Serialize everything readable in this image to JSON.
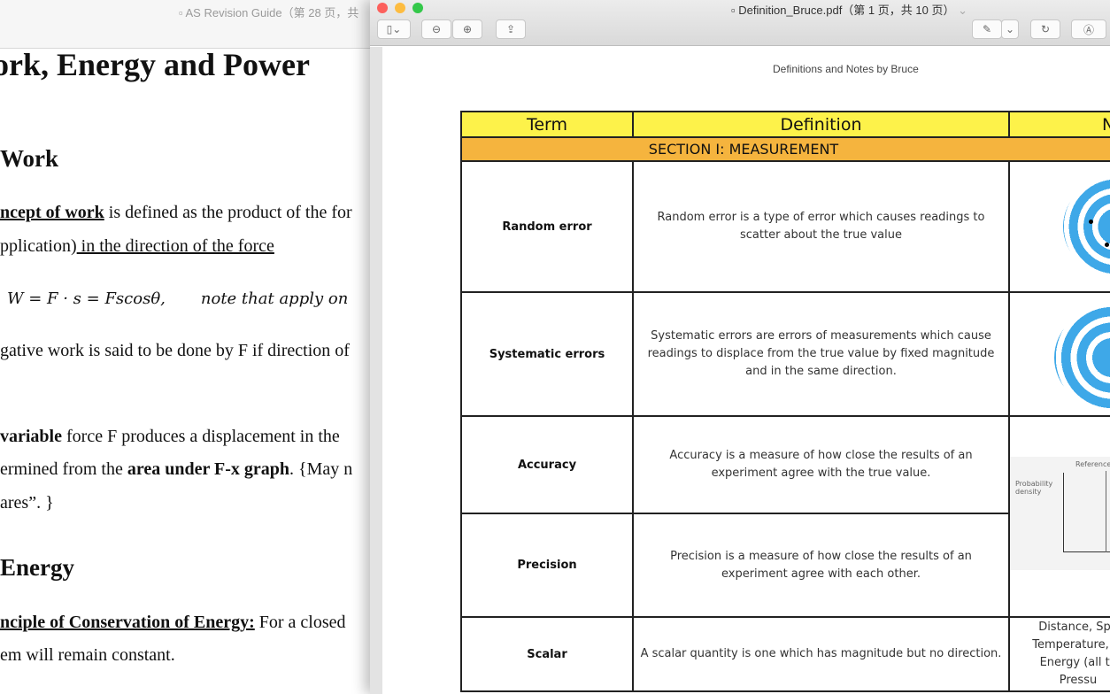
{
  "left_window": {
    "title": "AS Revision Guide（第 28 页，共",
    "heading": "ork, Energy and Power",
    "section_work": "Work",
    "line1_bold": "ncept of work",
    "line1_rest": " is defined as the product of the for",
    "line2_a": "pplication)",
    "line2_b": " in the direction of the force",
    "formula": "W = F · s = Fscosθ,",
    "formula_note": "note that apply on",
    "line3": "gative work is said to be done by F if direction of",
    "line4_bold": "variable",
    "line4_rest": " force F produces a displacement in the",
    "line5_a": "ermined from the ",
    "line5_bold": "area under F-x graph",
    "line5_c": ". {May n",
    "line6": "ares”. }",
    "section_energy": "Energy",
    "line7_bold": "nciple of Conservation of Energy:",
    "line7_rest": " For a closed",
    "line8": "em will remain constant."
  },
  "right_window": {
    "title": "Definition_Bruce.pdf（第 1 页，共 10 页）",
    "toolbar": {
      "sidebar": "▯⌄",
      "zoom_out": "⊖",
      "zoom_in": "⊕",
      "share": "⇪",
      "markup": "✎",
      "markup_menu": "⌄",
      "rotate": "↻",
      "annotate": "Ⓐ"
    },
    "page_header": "Definitions and Notes by Bruce",
    "table": {
      "headers": [
        "Term",
        "Definition",
        "N"
      ],
      "section": "SECTION I: MEASUREMENT",
      "rows": [
        {
          "term": "Random error",
          "definition": "Random error is a type of error which causes readings to scatter about the true value"
        },
        {
          "term": "Systematic errors",
          "definition": "Systematic errors are errors of measurements which cause readings to displace from the true value by fixed magnitude and in the same direction."
        },
        {
          "term": "Accuracy",
          "definition": "Accuracy is a measure of how close the results of an experiment agree with the true value."
        },
        {
          "term": "Precision",
          "definition": "Precision is a measure of how close the results of an experiment agree with each other."
        },
        {
          "term": "Scalar",
          "definition": "A scalar quantity is one which has magnitude but no direction.",
          "notes": "Distance, Spe Temperature, W Energy (all ty Pressu"
        }
      ],
      "graph_labels": {
        "y": "Probability density",
        "ref": "Reference"
      }
    },
    "colors": {
      "header": "#fdf24a",
      "section": "#f5b43e",
      "target": "#3ea8e8"
    }
  }
}
